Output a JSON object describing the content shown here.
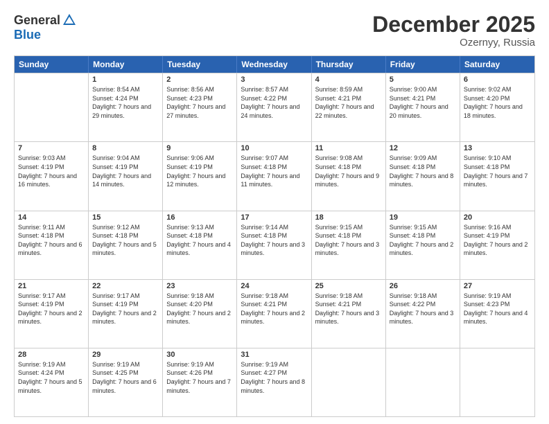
{
  "logo": {
    "general": "General",
    "blue": "Blue"
  },
  "title": {
    "month": "December 2025",
    "location": "Ozernyy, Russia"
  },
  "header_days": [
    "Sunday",
    "Monday",
    "Tuesday",
    "Wednesday",
    "Thursday",
    "Friday",
    "Saturday"
  ],
  "weeks": [
    [
      {
        "day": "",
        "sunrise": "",
        "sunset": "",
        "daylight": ""
      },
      {
        "day": "1",
        "sunrise": "Sunrise: 8:54 AM",
        "sunset": "Sunset: 4:24 PM",
        "daylight": "Daylight: 7 hours and 29 minutes."
      },
      {
        "day": "2",
        "sunrise": "Sunrise: 8:56 AM",
        "sunset": "Sunset: 4:23 PM",
        "daylight": "Daylight: 7 hours and 27 minutes."
      },
      {
        "day": "3",
        "sunrise": "Sunrise: 8:57 AM",
        "sunset": "Sunset: 4:22 PM",
        "daylight": "Daylight: 7 hours and 24 minutes."
      },
      {
        "day": "4",
        "sunrise": "Sunrise: 8:59 AM",
        "sunset": "Sunset: 4:21 PM",
        "daylight": "Daylight: 7 hours and 22 minutes."
      },
      {
        "day": "5",
        "sunrise": "Sunrise: 9:00 AM",
        "sunset": "Sunset: 4:21 PM",
        "daylight": "Daylight: 7 hours and 20 minutes."
      },
      {
        "day": "6",
        "sunrise": "Sunrise: 9:02 AM",
        "sunset": "Sunset: 4:20 PM",
        "daylight": "Daylight: 7 hours and 18 minutes."
      }
    ],
    [
      {
        "day": "7",
        "sunrise": "Sunrise: 9:03 AM",
        "sunset": "Sunset: 4:19 PM",
        "daylight": "Daylight: 7 hours and 16 minutes."
      },
      {
        "day": "8",
        "sunrise": "Sunrise: 9:04 AM",
        "sunset": "Sunset: 4:19 PM",
        "daylight": "Daylight: 7 hours and 14 minutes."
      },
      {
        "day": "9",
        "sunrise": "Sunrise: 9:06 AM",
        "sunset": "Sunset: 4:19 PM",
        "daylight": "Daylight: 7 hours and 12 minutes."
      },
      {
        "day": "10",
        "sunrise": "Sunrise: 9:07 AM",
        "sunset": "Sunset: 4:18 PM",
        "daylight": "Daylight: 7 hours and 11 minutes."
      },
      {
        "day": "11",
        "sunrise": "Sunrise: 9:08 AM",
        "sunset": "Sunset: 4:18 PM",
        "daylight": "Daylight: 7 hours and 9 minutes."
      },
      {
        "day": "12",
        "sunrise": "Sunrise: 9:09 AM",
        "sunset": "Sunset: 4:18 PM",
        "daylight": "Daylight: 7 hours and 8 minutes."
      },
      {
        "day": "13",
        "sunrise": "Sunrise: 9:10 AM",
        "sunset": "Sunset: 4:18 PM",
        "daylight": "Daylight: 7 hours and 7 minutes."
      }
    ],
    [
      {
        "day": "14",
        "sunrise": "Sunrise: 9:11 AM",
        "sunset": "Sunset: 4:18 PM",
        "daylight": "Daylight: 7 hours and 6 minutes."
      },
      {
        "day": "15",
        "sunrise": "Sunrise: 9:12 AM",
        "sunset": "Sunset: 4:18 PM",
        "daylight": "Daylight: 7 hours and 5 minutes."
      },
      {
        "day": "16",
        "sunrise": "Sunrise: 9:13 AM",
        "sunset": "Sunset: 4:18 PM",
        "daylight": "Daylight: 7 hours and 4 minutes."
      },
      {
        "day": "17",
        "sunrise": "Sunrise: 9:14 AM",
        "sunset": "Sunset: 4:18 PM",
        "daylight": "Daylight: 7 hours and 3 minutes."
      },
      {
        "day": "18",
        "sunrise": "Sunrise: 9:15 AM",
        "sunset": "Sunset: 4:18 PM",
        "daylight": "Daylight: 7 hours and 3 minutes."
      },
      {
        "day": "19",
        "sunrise": "Sunrise: 9:15 AM",
        "sunset": "Sunset: 4:18 PM",
        "daylight": "Daylight: 7 hours and 2 minutes."
      },
      {
        "day": "20",
        "sunrise": "Sunrise: 9:16 AM",
        "sunset": "Sunset: 4:19 PM",
        "daylight": "Daylight: 7 hours and 2 minutes."
      }
    ],
    [
      {
        "day": "21",
        "sunrise": "Sunrise: 9:17 AM",
        "sunset": "Sunset: 4:19 PM",
        "daylight": "Daylight: 7 hours and 2 minutes."
      },
      {
        "day": "22",
        "sunrise": "Sunrise: 9:17 AM",
        "sunset": "Sunset: 4:19 PM",
        "daylight": "Daylight: 7 hours and 2 minutes."
      },
      {
        "day": "23",
        "sunrise": "Sunrise: 9:18 AM",
        "sunset": "Sunset: 4:20 PM",
        "daylight": "Daylight: 7 hours and 2 minutes."
      },
      {
        "day": "24",
        "sunrise": "Sunrise: 9:18 AM",
        "sunset": "Sunset: 4:21 PM",
        "daylight": "Daylight: 7 hours and 2 minutes."
      },
      {
        "day": "25",
        "sunrise": "Sunrise: 9:18 AM",
        "sunset": "Sunset: 4:21 PM",
        "daylight": "Daylight: 7 hours and 3 minutes."
      },
      {
        "day": "26",
        "sunrise": "Sunrise: 9:18 AM",
        "sunset": "Sunset: 4:22 PM",
        "daylight": "Daylight: 7 hours and 3 minutes."
      },
      {
        "day": "27",
        "sunrise": "Sunrise: 9:19 AM",
        "sunset": "Sunset: 4:23 PM",
        "daylight": "Daylight: 7 hours and 4 minutes."
      }
    ],
    [
      {
        "day": "28",
        "sunrise": "Sunrise: 9:19 AM",
        "sunset": "Sunset: 4:24 PM",
        "daylight": "Daylight: 7 hours and 5 minutes."
      },
      {
        "day": "29",
        "sunrise": "Sunrise: 9:19 AM",
        "sunset": "Sunset: 4:25 PM",
        "daylight": "Daylight: 7 hours and 6 minutes."
      },
      {
        "day": "30",
        "sunrise": "Sunrise: 9:19 AM",
        "sunset": "Sunset: 4:26 PM",
        "daylight": "Daylight: 7 hours and 7 minutes."
      },
      {
        "day": "31",
        "sunrise": "Sunrise: 9:19 AM",
        "sunset": "Sunset: 4:27 PM",
        "daylight": "Daylight: 7 hours and 8 minutes."
      },
      {
        "day": "",
        "sunrise": "",
        "sunset": "",
        "daylight": ""
      },
      {
        "day": "",
        "sunrise": "",
        "sunset": "",
        "daylight": ""
      },
      {
        "day": "",
        "sunrise": "",
        "sunset": "",
        "daylight": ""
      }
    ]
  ]
}
